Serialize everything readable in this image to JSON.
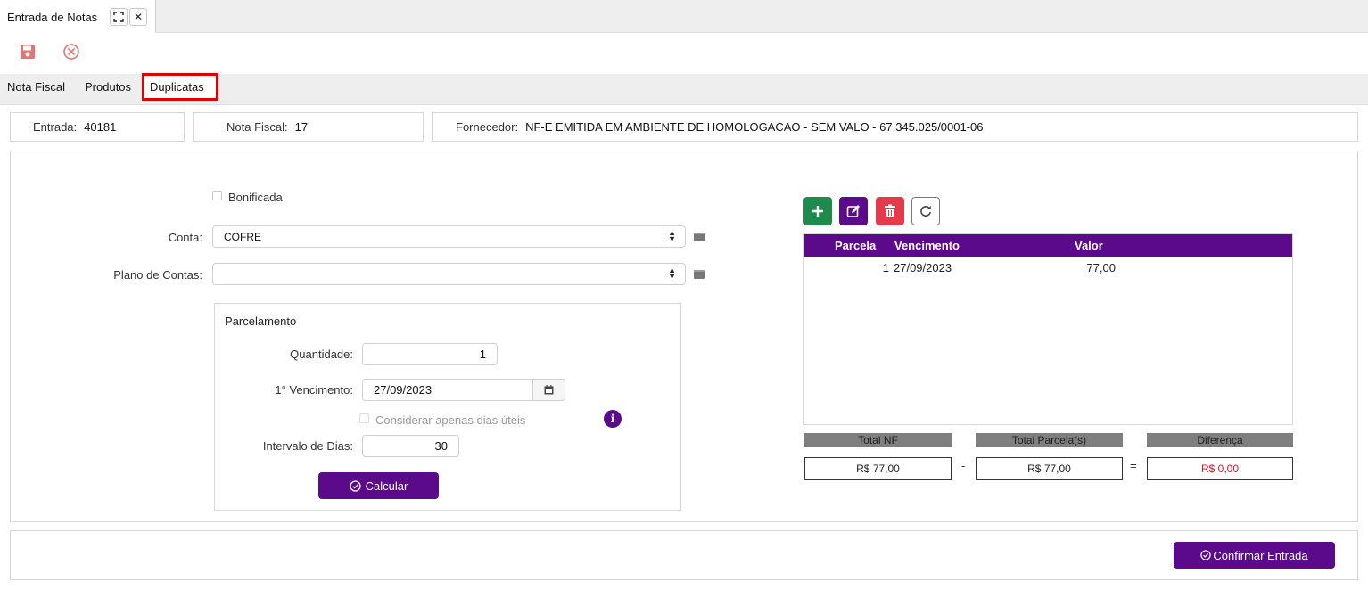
{
  "window": {
    "tab_title": "Entrada de Notas",
    "close_glyph": "✕"
  },
  "toolbar": {
    "save_icon": "save-icon",
    "cancel_icon": "cancel-icon",
    "icon_color": "#e57373"
  },
  "section_tabs": [
    {
      "label": "Nota Fiscal"
    },
    {
      "label": "Produtos"
    },
    {
      "label": "Duplicatas"
    }
  ],
  "header": {
    "entrada_label": "Entrada:",
    "entrada_value": "40181",
    "nota_label": "Nota Fiscal:",
    "nota_value": "17",
    "fornecedor_label": "Fornecedor:",
    "fornecedor_value": "NF-E EMITIDA EM AMBIENTE DE HOMOLOGACAO - SEM VALO - 67.345.025/0001-06"
  },
  "form": {
    "bonificada_label": "Bonificada",
    "conta_label": "Conta:",
    "conta_value": "COFRE",
    "plano_label": "Plano de Contas:",
    "plano_value": ""
  },
  "parcelamento": {
    "title": "Parcelamento",
    "quantidade_label": "Quantidade:",
    "quantidade_value": "1",
    "vencimento_label": "1° Vencimento:",
    "vencimento_value": "27/09/2023",
    "dias_uteis_label": "Considerar apenas dias úteis",
    "intervalo_label": "Intervalo de Dias:",
    "intervalo_value": "30",
    "calcular_label": "Calcular"
  },
  "duplicatas": {
    "columns": [
      "Parcela",
      "Vencimento",
      "Valor"
    ],
    "rows": [
      {
        "parcela": "1",
        "vencimento": "27/09/2023",
        "valor": "77,00"
      }
    ]
  },
  "totals": {
    "total_nf_label": "Total NF",
    "total_nf_value": "R$ 77,00",
    "minus": "-",
    "total_parcelas_label": "Total Parcela(s)",
    "total_parcelas_value": "R$ 77,00",
    "equals": "=",
    "diferenca_label": "Diferença",
    "diferenca_value": "R$ 0,00"
  },
  "footer": {
    "confirm_label": "Confirmar Entrada"
  },
  "colors": {
    "purple": "#5a0a8a",
    "green": "#1e8a4c",
    "red": "#e33a4c",
    "active_tab_border": "#e00000",
    "difference_text": "#d11a2a"
  }
}
